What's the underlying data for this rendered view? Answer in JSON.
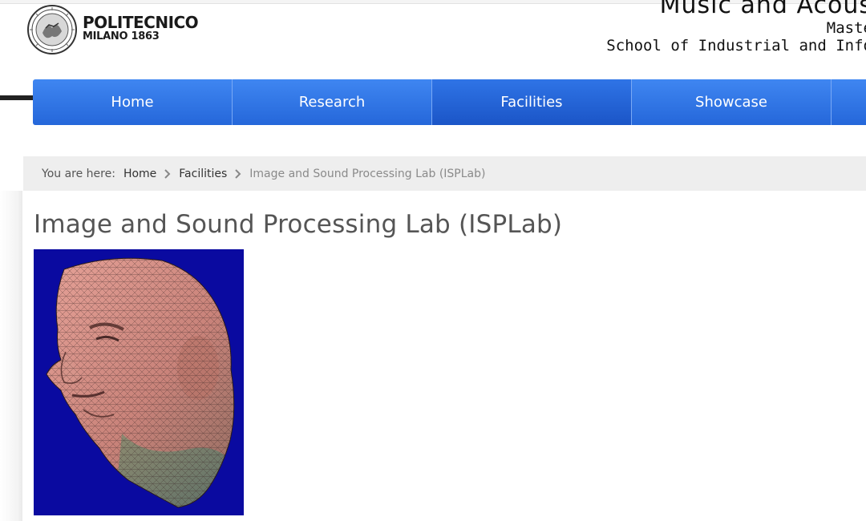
{
  "brand": {
    "name": "POLITECNICO",
    "sub": "MILANO 1863"
  },
  "site": {
    "title": "Music and Acous",
    "line2": "Maste",
    "line3": "School of Industrial and Info"
  },
  "nav": {
    "items": [
      {
        "label": "Home"
      },
      {
        "label": "Research"
      },
      {
        "label": "Facilities"
      },
      {
        "label": "Showcase"
      },
      {
        "label": ""
      }
    ],
    "active": "Facilities"
  },
  "breadcrumb": {
    "label": "You are here:",
    "items": [
      {
        "label": "Home"
      },
      {
        "label": "Facilities"
      }
    ],
    "current": "Image and Sound Processing Lab (ISPLab)"
  },
  "page": {
    "title": "Image and Sound Processing Lab (ISPLab)"
  },
  "colors": {
    "nav_blue": "#2f6fe3",
    "image_background": "#0a0aa0"
  }
}
